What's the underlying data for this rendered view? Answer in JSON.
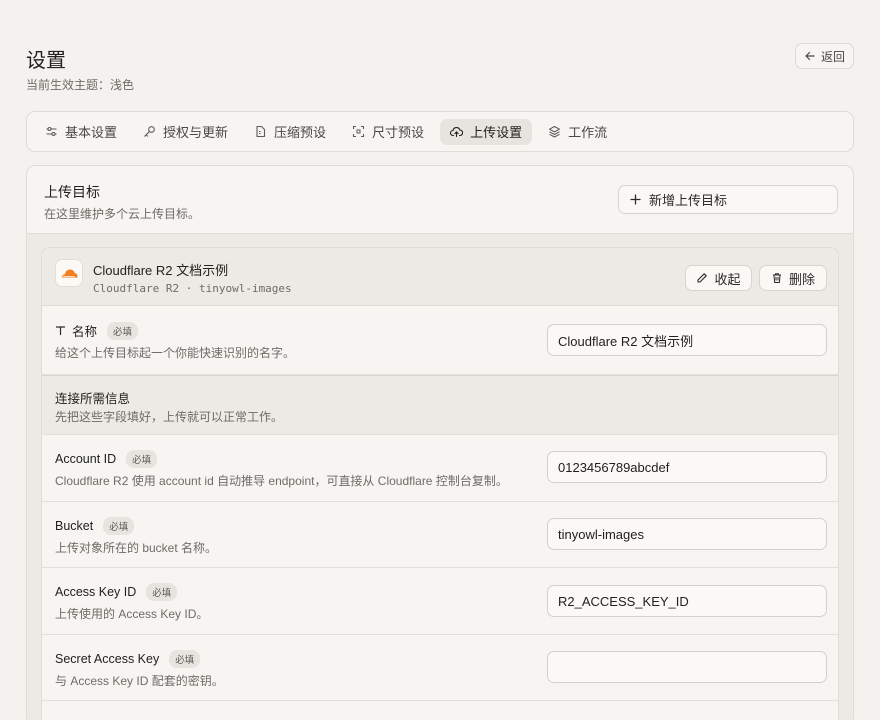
{
  "page": {
    "title": "设置",
    "subtitle": "当前生效主题：浅色",
    "back_label": "返回"
  },
  "tabs": [
    {
      "label": "基本设置",
      "icon": "sliders-icon",
      "active": false
    },
    {
      "label": "授权与更新",
      "icon": "key-icon",
      "active": false
    },
    {
      "label": "压缩预设",
      "icon": "file-zip-icon",
      "active": false
    },
    {
      "label": "尺寸预设",
      "icon": "crop-icon",
      "active": false
    },
    {
      "label": "上传设置",
      "icon": "cloud-upload-icon",
      "active": true
    },
    {
      "label": "工作流",
      "icon": "layers-icon",
      "active": false
    }
  ],
  "panel": {
    "title": "上传目标",
    "desc": "在这里维护多个云上传目标。",
    "add_label": "新增上传目标"
  },
  "card": {
    "name": "Cloudflare R2 文档示例",
    "sub": "Cloudflare R2 · tinyowl-images",
    "collapse_label": "收起",
    "delete_label": "删除"
  },
  "name_field": {
    "label": "名称",
    "badge": "必填",
    "desc": "给这个上传目标起一个你能快速识别的名字。",
    "value": "Cloudflare R2 文档示例"
  },
  "section": {
    "title": "连接所需信息",
    "desc": "先把这些字段填好，上传就可以正常工作。"
  },
  "fields": [
    {
      "label": "Account ID",
      "badge": "必填",
      "desc": "Cloudflare R2 使用 account id 自动推导 endpoint，可直接从 Cloudflare 控制台复制。",
      "value": "0123456789abcdef"
    },
    {
      "label": "Bucket",
      "badge": "必填",
      "desc": "上传对象所在的 bucket 名称。",
      "value": "tinyowl-images"
    },
    {
      "label": "Access Key ID",
      "badge": "必填",
      "desc": "上传使用的 Access Key ID。",
      "value": "R2_ACCESS_KEY_ID"
    },
    {
      "label": "Secret Access Key",
      "badge": "必填",
      "desc": "与 Access Key ID 配套的密钥。",
      "value": ""
    }
  ],
  "colors": {
    "background": "#f3f2ee",
    "accent": "#f38020"
  }
}
